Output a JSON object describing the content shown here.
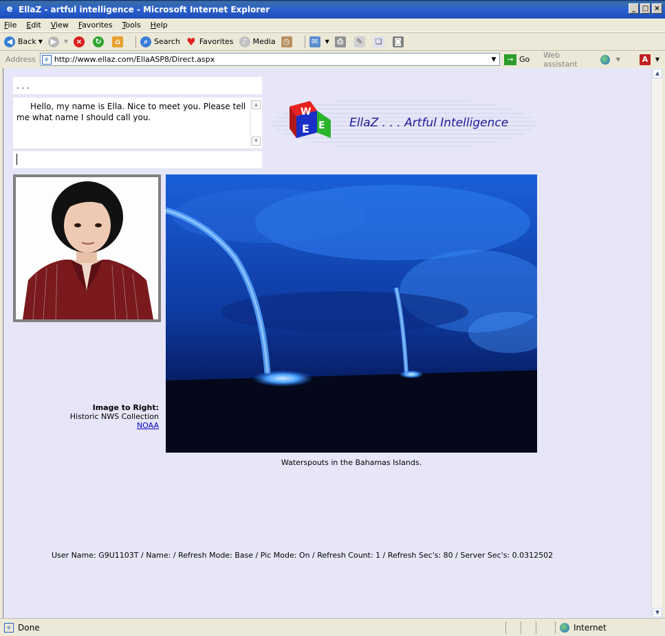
{
  "window": {
    "title": "EllaZ - artful intelligence - Microsoft Internet Explorer"
  },
  "menu": [
    "File",
    "Edit",
    "View",
    "Favorites",
    "Tools",
    "Help"
  ],
  "toolbar": {
    "back": "Back",
    "search": "Search",
    "favorites": "Favorites",
    "media": "Media"
  },
  "address": {
    "label": "Address",
    "url": "http://www.ellaz.com/EllaASP8/Direct.aspx",
    "go": "Go",
    "web_assistant": "Web assistant"
  },
  "chat": {
    "top_text": ". . .",
    "message": "Hello, my name is Ella.  Nice to meet you.  Please tell me what name I should call you.",
    "input_value": ""
  },
  "logo": {
    "text": "EllaZ . . . Artful Intelligence",
    "colors": {
      "red": "#e8231f",
      "green": "#2bb32b",
      "blue": "#1a2fc7",
      "text": "#1a1a9a"
    }
  },
  "credit": {
    "title": "Image to Right:",
    "source": "Historic NWS Collection",
    "link": "NOAA"
  },
  "photo": {
    "caption": "Waterspouts in the Bahamas Islands."
  },
  "page_status": "User Name: G9U1103T / Name:  / Refresh Mode: Base / Pic Mode: On / Refresh Count: 1 / Refresh Sec's: 80 / Server Sec's: 0.0312502",
  "statusbar": {
    "state": "Done",
    "zone": "Internet"
  }
}
